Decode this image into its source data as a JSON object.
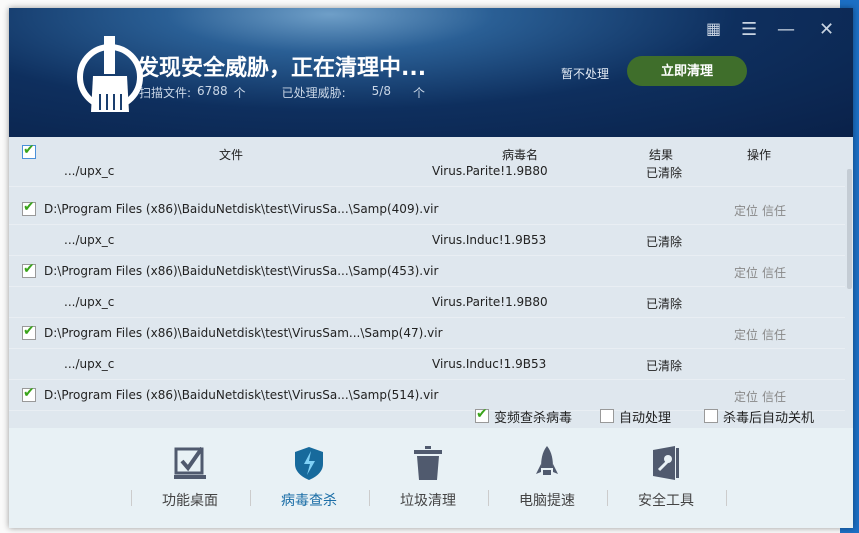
{
  "header": {
    "title": "发现安全威胁，正在清理中...",
    "scan_label": "扫描文件:",
    "scan_count": "6788",
    "unit": "个",
    "threat_label": "已处理威胁:",
    "threat_count": "5/8",
    "skip": "暂不处理",
    "clean_now": "立即清理"
  },
  "columns": {
    "file": "文件",
    "virus": "病毒名",
    "result": "结果",
    "action": "操作"
  },
  "rows": [
    {
      "type": "sub",
      "file": ".../upx_c",
      "virus": "Virus.Parite!1.9B80",
      "result": "已清除"
    },
    {
      "type": "main",
      "file": "D:\\Program Files (x86)\\BaiduNetdisk\\test\\VirusSa...\\Samp(409).vir",
      "locate": "定位",
      "trust": "信任"
    },
    {
      "type": "sub",
      "file": ".../upx_c",
      "virus": "Virus.Induc!1.9B53",
      "result": "已清除"
    },
    {
      "type": "main",
      "file": "D:\\Program Files (x86)\\BaiduNetdisk\\test\\VirusSa...\\Samp(453).vir",
      "locate": "定位",
      "trust": "信任"
    },
    {
      "type": "sub",
      "file": ".../upx_c",
      "virus": "Virus.Parite!1.9B80",
      "result": "已清除"
    },
    {
      "type": "main",
      "file": "D:\\Program Files (x86)\\BaiduNetdisk\\test\\VirusSam...\\Samp(47).vir",
      "locate": "定位",
      "trust": "信任"
    },
    {
      "type": "sub",
      "file": ".../upx_c",
      "virus": "Virus.Induc!1.9B53",
      "result": "已清除"
    },
    {
      "type": "main",
      "file": "D:\\Program Files (x86)\\BaiduNetdisk\\test\\VirusSa...\\Samp(514).vir",
      "locate": "定位",
      "trust": "信任"
    }
  ],
  "options": {
    "freq": "变频查杀病毒",
    "auto": "自动处理",
    "shutdown": "杀毒后自动关机"
  },
  "nav": [
    "功能桌面",
    "病毒查杀",
    "垃圾清理",
    "电脑提速",
    "安全工具"
  ]
}
